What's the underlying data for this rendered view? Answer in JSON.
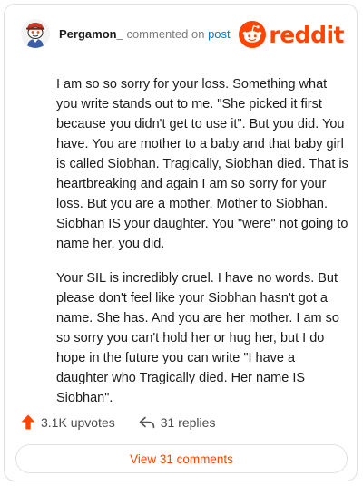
{
  "header": {
    "username": "Pergamon_",
    "commented_on": "commented on",
    "post_link": "post",
    "avatar_icon": "snoo-avatar-icon"
  },
  "brand": {
    "wordmark": "reddit",
    "logo_icon": "reddit-snoo-icon",
    "color": "#ff4500"
  },
  "comment": {
    "paragraphs": [
      "I am so so sorry for your loss. Something what you write stands out to me. \"She picked it first because you didn't get to use it\". But you did. You have. You are mother to a baby and that baby girl is called Siobhan. Tragically,  Siobhan died. That is heartbreaking and again I am so sorry for your loss. But you are a mother. Mother to Siobhan. Siobhan IS your daughter. You \"were\" not going to name her, you did.",
      "Your SIL is incredibly cruel. I have no words. But please don't feel like your Siobhan hasn't got a name. She has. And you are her mother. I am so so sorry you can't hold her or hug her, but I do hope in the future you can write \"I have a daughter who Tragically died. Her name IS Siobhan\"."
    ]
  },
  "actions": {
    "upvotes_label": "3.1K upvotes",
    "upvote_icon": "upvote-arrow-icon",
    "replies_label": "31 replies",
    "reply_icon": "reply-arrow-icon"
  },
  "footer": {
    "view_comments_label": "View 31 comments"
  },
  "colors": {
    "accent": "#ff4500",
    "link": "#0079d3",
    "text": "#1c1c1c",
    "muted": "#7c7c7c"
  }
}
